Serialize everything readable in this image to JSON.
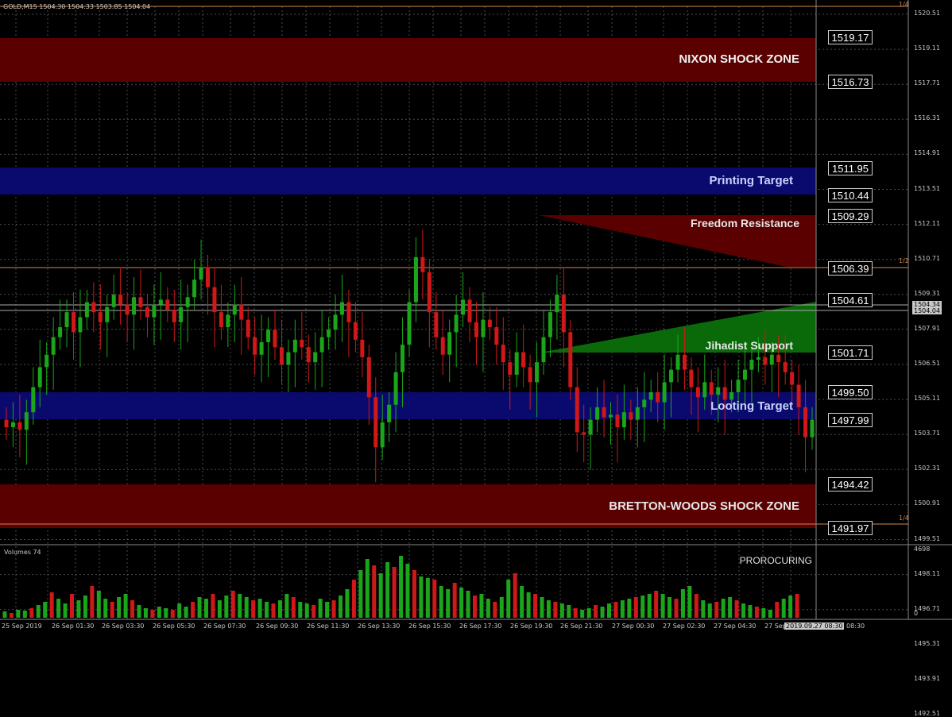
{
  "window": {
    "symbol_info": "GOLD,M15  1504.30 1504.33 1503.85 1504.04"
  },
  "colors": {
    "background": "#000000",
    "grid": "#4a4a4a",
    "bull_candle": "#1aa51a",
    "bear_candle": "#d01818",
    "shock_zone": "#5a0000",
    "target_zone": "#0a0a6e",
    "resistance_zone": "#5a0000",
    "support_zone": "#0a6a0a",
    "fib_line": "#d28a4e",
    "price_line": "#aaaaaa"
  },
  "zones": [
    {
      "label": "NIXON SHOCK ZONE",
      "color": "#f0f0f0"
    },
    {
      "label": "Printing Target",
      "color": "#c8d2ff"
    },
    {
      "label": "Freedom Resistance",
      "color": "#e6e6e6"
    },
    {
      "label": "Jihadist Support",
      "color": "#e6e6e6"
    },
    {
      "label": "Looting Target",
      "color": "#c8d2ff"
    },
    {
      "label": "BRETTON-WOODS SHOCK ZONE",
      "color": "#e6e6e6"
    }
  ],
  "level_labels": [
    "1519.17",
    "1516.73",
    "1511.95",
    "1510.44",
    "1509.29",
    "1506.39",
    "1504.61",
    "1501.71",
    "1499.50",
    "1497.99",
    "1494.42",
    "1491.97"
  ],
  "price_axis": [
    "1520.51",
    "1519.11",
    "1517.71",
    "1516.31",
    "1514.91",
    "1513.51",
    "1512.11",
    "1510.71",
    "1509.31",
    "1507.91",
    "1506.51",
    "1505.11",
    "1503.71",
    "1502.31",
    "1500.91",
    "1499.51",
    "1498.11",
    "1496.71",
    "1495.31",
    "1493.91",
    "1492.51"
  ],
  "current_price": {
    "bid": "1504.34",
    "ask": "1504.04"
  },
  "fib_labels": {
    "top": "1/4",
    "middle": "1/2",
    "bottom": "1/4"
  },
  "volume_panel": {
    "title": "Volumes 74",
    "axis_top": "4698",
    "axis_bottom": "0",
    "indicator_label": "PROROCURING"
  },
  "time_axis": [
    "25 Sep 2019",
    "26 Sep 01:30",
    "26 Sep 03:30",
    "26 Sep 05:30",
    "26 Sep 07:30",
    "26 Sep 09:30",
    "26 Sep 11:30",
    "26 Sep 13:30",
    "26 Sep 15:30",
    "26 Sep 17:30",
    "26 Sep 19:30",
    "26 Sep 21:30",
    "27 Sep 00:30",
    "27 Sep 02:30",
    "27 Sep 04:30",
    "27 Sep",
    "08:30"
  ],
  "cursor_time": "2019.09.27 08:30"
}
